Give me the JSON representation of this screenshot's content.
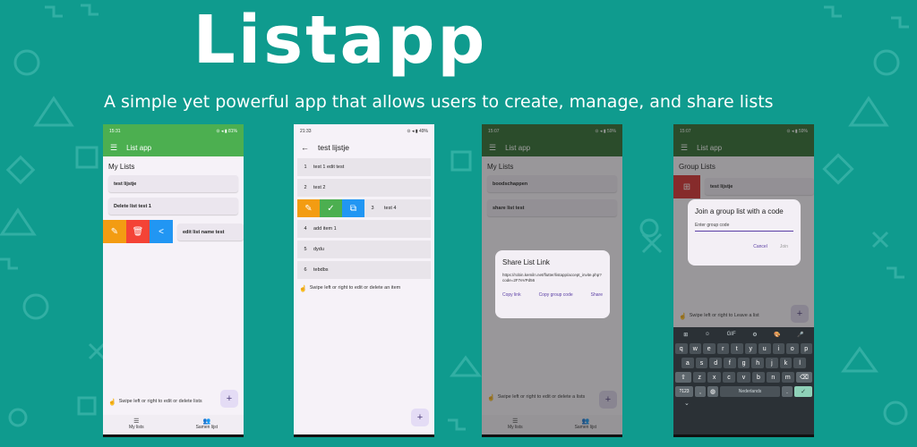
{
  "hero": {
    "title": "Listapp",
    "subtitle": "A simple yet powerful app that allows users to create, manage, and share lists"
  },
  "colors": {
    "background": "#0f9b8e",
    "green": "#4caf50",
    "dark_green": "#2e6b2e",
    "purple": "#5b3fa5"
  },
  "phone1": {
    "status_time": "15:31",
    "status_right": "⊙ ◂ ▮ 81%",
    "app_title": "List app",
    "section": "My Lists",
    "items": [
      "test lijstje",
      "Delete list test 1"
    ],
    "swipe_item": "edit list name test",
    "hint": "Swipe left or right to edit or delete lists",
    "fab": "+",
    "nav": [
      {
        "icon": "list-icon",
        "label": "My lists"
      },
      {
        "icon": "group-icon",
        "label": "Samen lijst"
      }
    ]
  },
  "phone2": {
    "status_time": "21:33",
    "status_right": "⊙ ◂ ▮ 49%",
    "title": "test lijstje",
    "rows": [
      {
        "n": "1",
        "text": "test 1 edit test"
      },
      {
        "n": "2",
        "text": "test 2"
      },
      {
        "n": "3",
        "text": "test 4"
      },
      {
        "n": "4",
        "text": "add item 1"
      },
      {
        "n": "5",
        "text": "dydu"
      },
      {
        "n": "6",
        "text": "tebdbs"
      }
    ],
    "hint": "Swipe left or right to edit or delete an item",
    "fab": "+"
  },
  "phone3": {
    "status_time": "15:07",
    "status_right": "⊙ ◂ ▮ 59%",
    "app_title": "List app",
    "section": "My Lists",
    "items": [
      "boodschappen",
      "share list test"
    ],
    "dialog": {
      "title": "Share List Link",
      "link": "https://robin.kemiln.net/flutter/listapp/accept_invite.php?code=2F7eVPd56",
      "actions": [
        "Copy link",
        "Copy group code",
        "Share"
      ]
    },
    "hint": "Swipe left or right to edit or delete a lists",
    "nav": [
      {
        "icon": "list-icon",
        "label": "My lists"
      },
      {
        "icon": "group-icon",
        "label": "Samen lijst"
      }
    ]
  },
  "phone4": {
    "status_time": "15:07",
    "status_right": "⊙ ◂ ▮ 59%",
    "app_title": "List app",
    "section": "Group Lists",
    "items": [
      "test lijstje"
    ],
    "dialog": {
      "title": "Join a group list with a code",
      "placeholder": "Enter group code",
      "actions": [
        "Cancel",
        "Join"
      ]
    },
    "hint": "Swipe left or right to Leave a list",
    "keyboard": {
      "toolbar": [
        "⊞",
        "☺",
        "GIF",
        "⚙",
        "🎨",
        "🎤"
      ],
      "row1": [
        "q",
        "w",
        "e",
        "r",
        "t",
        "y",
        "u",
        "i",
        "o",
        "p"
      ],
      "row2": [
        "a",
        "s",
        "d",
        "f",
        "g",
        "h",
        "j",
        "k",
        "l"
      ],
      "row3": [
        "z",
        "x",
        "c",
        "v",
        "b",
        "n",
        "m"
      ],
      "sym": "?123",
      "comma": ",",
      "space": "Nederlands",
      "period": "."
    }
  }
}
